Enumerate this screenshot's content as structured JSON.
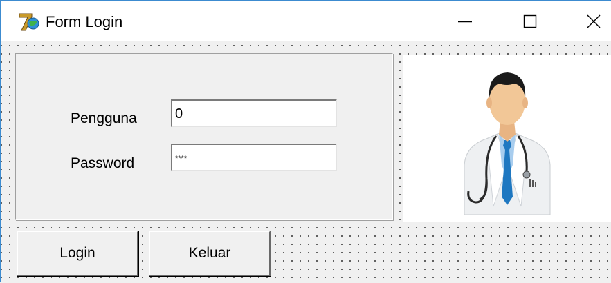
{
  "window": {
    "title": "Form Login",
    "icon": "app-logo-icon"
  },
  "title_controls": {
    "minimize_icon": "minimize-icon",
    "maximize_icon": "maximize-icon",
    "close_icon": "close-icon"
  },
  "form": {
    "user_label": "Pengguna",
    "user_value": "0",
    "password_label": "Password",
    "password_value": "****",
    "doctor_image": "doctor-avatar-icon"
  },
  "buttons": {
    "login_label": "Login",
    "exit_label": "Keluar"
  },
  "colors": {
    "window_border": "#3c8bd0",
    "face": "#f0f0f0",
    "titlebar": "#ffffff",
    "tie": "#1f78c1"
  }
}
